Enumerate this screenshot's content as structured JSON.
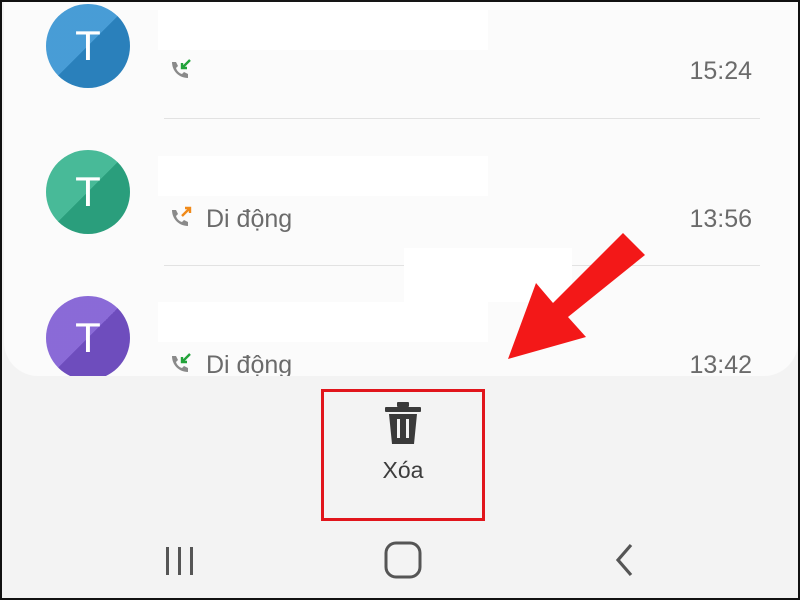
{
  "calls": [
    {
      "initial": "T",
      "avatar_color": "#2f8fd0",
      "direction": "incoming",
      "type_label": "",
      "time": "15:24"
    },
    {
      "initial": "T",
      "avatar_color": "#2fb08a",
      "direction": "outgoing",
      "type_label": "Di động",
      "time": "13:56"
    },
    {
      "initial": "T",
      "avatar_color": "#7a56d2",
      "direction": "incoming",
      "type_label": "Di động",
      "time": "13:42"
    }
  ],
  "action_bar": {
    "delete_label": "Xóa",
    "delete_icon": "trash-icon"
  },
  "navbar": {
    "recents_icon": "recents-icon",
    "home_icon": "home-icon",
    "back_icon": "back-icon"
  },
  "colors": {
    "incoming_arrow": "#22a33a",
    "outgoing_arrow": "#f08a1a",
    "highlight": "#e1151b"
  }
}
